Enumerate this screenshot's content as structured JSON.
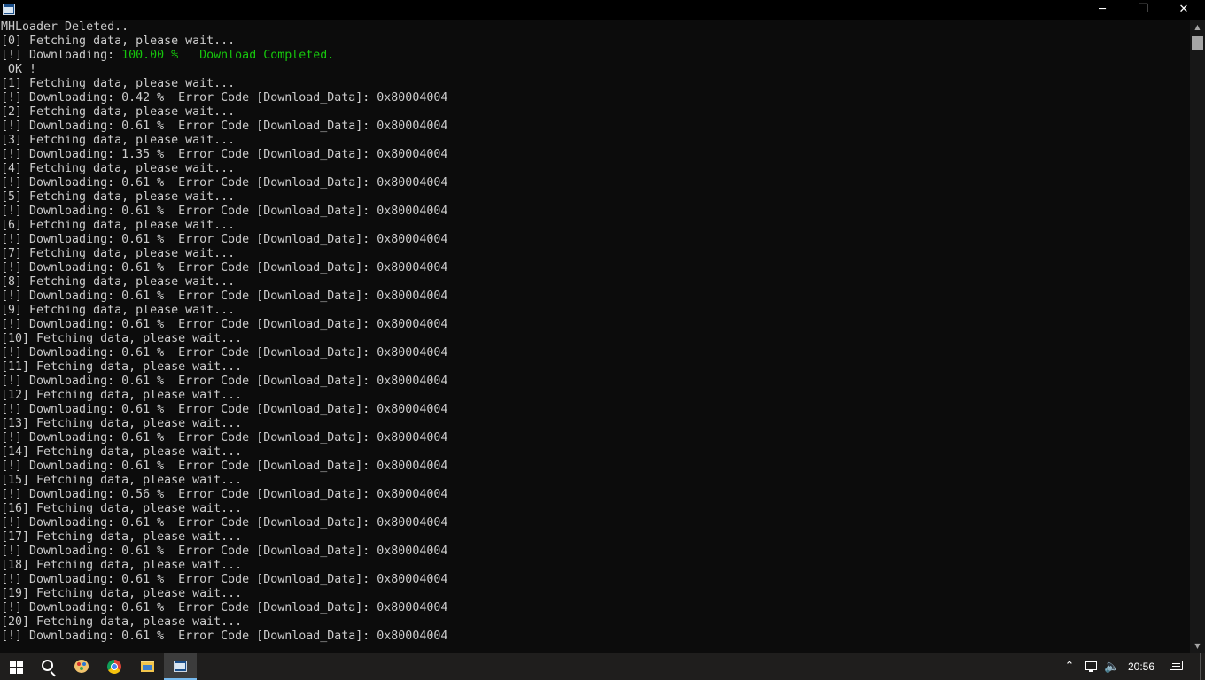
{
  "window": {
    "title_icon": "console-window-icon",
    "controls": {
      "minimize": "─",
      "maximize": "❐",
      "close": "✕"
    }
  },
  "console": {
    "text_color": "#cccccc",
    "accent_color": "#16c60c",
    "background": "#0c0c0c",
    "lines": [
      [
        {
          "t": "MHLoader Deleted.."
        }
      ],
      [
        {
          "t": "[0] Fetching data, please wait..."
        }
      ],
      [
        {
          "t": "[!] Downloading: "
        },
        {
          "t": "100.00 %   Download Completed.",
          "g": true
        }
      ],
      [
        {
          "t": " OK !"
        }
      ],
      [
        {
          "t": "[1] Fetching data, please wait..."
        }
      ],
      [
        {
          "t": "[!] Downloading: 0.42 %  Error Code [Download_Data]: 0x80004004"
        }
      ],
      [
        {
          "t": "[2] Fetching data, please wait..."
        }
      ],
      [
        {
          "t": "[!] Downloading: 0.61 %  Error Code [Download_Data]: 0x80004004"
        }
      ],
      [
        {
          "t": "[3] Fetching data, please wait..."
        }
      ],
      [
        {
          "t": "[!] Downloading: 1.35 %  Error Code [Download_Data]: 0x80004004"
        }
      ],
      [
        {
          "t": "[4] Fetching data, please wait..."
        }
      ],
      [
        {
          "t": "[!] Downloading: 0.61 %  Error Code [Download_Data]: 0x80004004"
        }
      ],
      [
        {
          "t": "[5] Fetching data, please wait..."
        }
      ],
      [
        {
          "t": "[!] Downloading: 0.61 %  Error Code [Download_Data]: 0x80004004"
        }
      ],
      [
        {
          "t": "[6] Fetching data, please wait..."
        }
      ],
      [
        {
          "t": "[!] Downloading: 0.61 %  Error Code [Download_Data]: 0x80004004"
        }
      ],
      [
        {
          "t": "[7] Fetching data, please wait..."
        }
      ],
      [
        {
          "t": "[!] Downloading: 0.61 %  Error Code [Download_Data]: 0x80004004"
        }
      ],
      [
        {
          "t": "[8] Fetching data, please wait..."
        }
      ],
      [
        {
          "t": "[!] Downloading: 0.61 %  Error Code [Download_Data]: 0x80004004"
        }
      ],
      [
        {
          "t": "[9] Fetching data, please wait..."
        }
      ],
      [
        {
          "t": "[!] Downloading: 0.61 %  Error Code [Download_Data]: 0x80004004"
        }
      ],
      [
        {
          "t": "[10] Fetching data, please wait..."
        }
      ],
      [
        {
          "t": "[!] Downloading: 0.61 %  Error Code [Download_Data]: 0x80004004"
        }
      ],
      [
        {
          "t": "[11] Fetching data, please wait..."
        }
      ],
      [
        {
          "t": "[!] Downloading: 0.61 %  Error Code [Download_Data]: 0x80004004"
        }
      ],
      [
        {
          "t": "[12] Fetching data, please wait..."
        }
      ],
      [
        {
          "t": "[!] Downloading: 0.61 %  Error Code [Download_Data]: 0x80004004"
        }
      ],
      [
        {
          "t": "[13] Fetching data, please wait..."
        }
      ],
      [
        {
          "t": "[!] Downloading: 0.61 %  Error Code [Download_Data]: 0x80004004"
        }
      ],
      [
        {
          "t": "[14] Fetching data, please wait..."
        }
      ],
      [
        {
          "t": "[!] Downloading: 0.61 %  Error Code [Download_Data]: 0x80004004"
        }
      ],
      [
        {
          "t": "[15] Fetching data, please wait..."
        }
      ],
      [
        {
          "t": "[!] Downloading: 0.56 %  Error Code [Download_Data]: 0x80004004"
        }
      ],
      [
        {
          "t": "[16] Fetching data, please wait..."
        }
      ],
      [
        {
          "t": "[!] Downloading: 0.61 %  Error Code [Download_Data]: 0x80004004"
        }
      ],
      [
        {
          "t": "[17] Fetching data, please wait..."
        }
      ],
      [
        {
          "t": "[!] Downloading: 0.61 %  Error Code [Download_Data]: 0x80004004"
        }
      ],
      [
        {
          "t": "[18] Fetching data, please wait..."
        }
      ],
      [
        {
          "t": "[!] Downloading: 0.61 %  Error Code [Download_Data]: 0x80004004"
        }
      ],
      [
        {
          "t": "[19] Fetching data, please wait..."
        }
      ],
      [
        {
          "t": "[!] Downloading: 0.61 %  Error Code [Download_Data]: 0x80004004"
        }
      ],
      [
        {
          "t": "[20] Fetching data, please wait..."
        }
      ],
      [
        {
          "t": "[!] Downloading: 0.61 %  Error Code [Download_Data]: 0x80004004"
        }
      ]
    ]
  },
  "scrollbar": {
    "up_glyph": "▲",
    "down_glyph": "▼"
  },
  "taskbar": {
    "items": [
      "windows-start-icon",
      "search-icon",
      "paint-app-icon",
      "chrome-icon",
      "file-explorer-icon",
      "console-window-icon"
    ],
    "tray": {
      "chevron": "⌃",
      "volume": "🔈"
    },
    "clock": "20:56"
  }
}
